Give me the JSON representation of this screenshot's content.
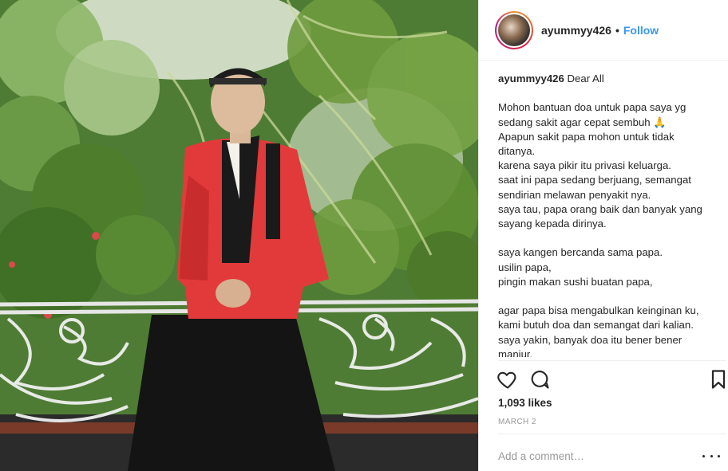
{
  "post": {
    "username": "ayummyy426",
    "follow_label": "Follow",
    "separator": "•",
    "caption": {
      "username": "ayummyy426",
      "first_line": "Dear All",
      "lines": [
        "",
        "Mohon bantuan doa untuk papa saya yg",
        "sedang sakit agar cepat sembuh 🙏",
        "Apapun sakit papa mohon untuk tidak",
        "ditanya.",
        "karena saya pikir itu privasi keluarga.",
        "saat ini papa sedang berjuang, semangat",
        "sendirian melawan penyakit nya.",
        "saya tau, papa orang baik dan banyak yang",
        "sayang kepada dirinya.",
        "",
        "saya kangen bercanda sama papa.",
        "usilin papa,",
        "pingin makan sushi buatan papa,",
        "",
        "agar papa bisa mengabulkan keinginan ku,",
        "kami butuh doa dan semangat dari kalian.",
        "saya yakin, banyak doa itu bener bener",
        "manjur."
      ]
    },
    "likes": "1,093 likes",
    "date": "MARCH 2",
    "comment_placeholder": "Add a comment…"
  },
  "icons": {
    "like": "heart-icon",
    "comment": "comment-icon",
    "save": "bookmark-icon",
    "more": "more-options-icon"
  },
  "colors": {
    "link": "#3897f0",
    "text": "#262626",
    "muted": "#999999",
    "border": "#efefef"
  }
}
